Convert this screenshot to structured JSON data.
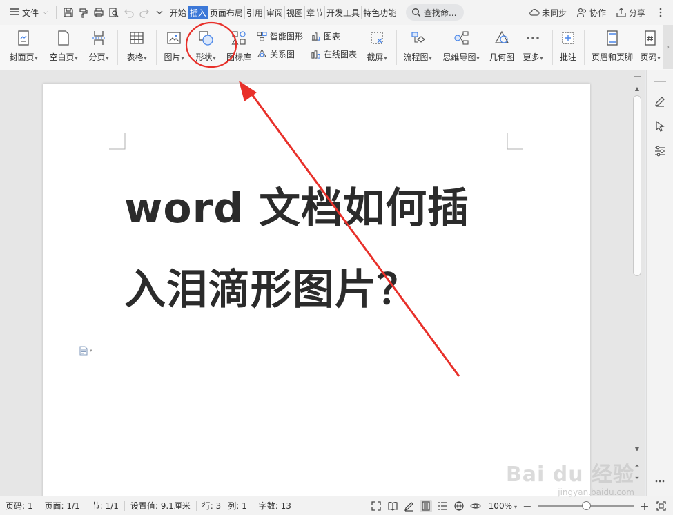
{
  "menubar": {
    "file_label": "文件",
    "tabs": [
      {
        "label": "开始",
        "active": false
      },
      {
        "label": "插入",
        "active": true
      },
      {
        "label": "页面布局",
        "active": false
      },
      {
        "label": "引用",
        "active": false
      },
      {
        "label": "审阅",
        "active": false
      },
      {
        "label": "视图",
        "active": false
      },
      {
        "label": "章节",
        "active": false
      },
      {
        "label": "开发工具",
        "active": false
      },
      {
        "label": "特色功能",
        "active": false
      }
    ],
    "search_label": "查找命...",
    "unsynced_label": "未同步",
    "collab_label": "协作",
    "share_label": "分享"
  },
  "ribbon": {
    "cover_label": "封面页",
    "blank_label": "空白页",
    "pagebreak_label": "分页",
    "table_label": "表格",
    "picture_label": "图片",
    "shape_label": "形状",
    "iconlib_label": "图标库",
    "smartart_label": "智能图形",
    "chart_label": "图表",
    "relation_label": "关系图",
    "onlinechart_label": "在线图表",
    "screenshot_label": "截屏",
    "flowchart_label": "流程图",
    "mindmap_label": "思维导图",
    "geometry_label": "几何图",
    "more_label": "更多",
    "comment_label": "批注",
    "headerfooter_label": "页眉和页脚",
    "pagenum_label": "页码"
  },
  "document": {
    "line1": "word 文档如何插",
    "line2": "入泪滴形图片？"
  },
  "statusbar": {
    "page_code": "页码: 1",
    "page": "页面: 1/1",
    "section": "节: 1/1",
    "setting": "设置值: 9.1厘米",
    "row": "行: 3",
    "col": "列: 1",
    "wordcount": "字数: 13",
    "zoom": "100%",
    "zoom_level": 0.5
  },
  "watermark": {
    "brand": "Bai du 经验",
    "url": "jingyan.baidu.com"
  },
  "colors": {
    "accent": "#3c78d8",
    "annotation": "#e8302a"
  }
}
